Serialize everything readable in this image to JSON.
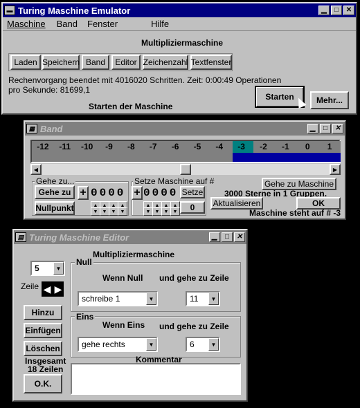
{
  "main": {
    "title": "Turing Maschine Emulator",
    "menu": [
      "Maschine",
      "Band",
      "Fenster",
      "Hilfe"
    ],
    "machine_name": "Multipliziermaschine",
    "toolbar": [
      "Laden",
      "Speichern",
      "Band",
      "Editor",
      "Zeichenzahl",
      "Textfenster"
    ],
    "status_line1": "Rechenvorgang beendet mit 4016020 Schritten. Zeit: 0:00:49 Operationen",
    "status_line2": "pro Sekunde: 81699,1",
    "start_caption": "Starten der Maschine",
    "start_button": "Starten",
    "more_button": "Mehr..."
  },
  "band": {
    "title": "Band",
    "cells": [
      "-12",
      "-11",
      "-10",
      "-9",
      "-8",
      "-7",
      "-6",
      "-5",
      "-4",
      "-3",
      "-2",
      "-1",
      "0",
      "1"
    ],
    "goto_group": "Gehe zu...",
    "goto_button": "Gehe zu",
    "zero_button": "Nullpunkt",
    "goto_digits": "0000",
    "set_group": "Setze Maschine auf #",
    "set_digits": "0000",
    "set_button": "Setze",
    "set_value": "0",
    "goto_machine_button": "Gehe zu Maschine",
    "stars_info": "3000 Sterne in   1 Gruppen.",
    "refresh_button": "Aktualisieren",
    "ok_button": "OK",
    "status": "Maschine steht auf # -3"
  },
  "editor": {
    "title": "Turing Maschine Editor",
    "machine_name": "Multipliziermaschine",
    "line_select": "5",
    "line_label": "Zeile",
    "add_button": "Hinzu",
    "insert_button": "Einfügen",
    "delete_button": "Löschen",
    "total_line1": "Insgesamt",
    "total_line2": "18 Zeilen",
    "ok_button": "O.K.",
    "null_group": "Null",
    "null_if": "Wenn Null",
    "null_goto": "und gehe zu Zeile",
    "null_action": "schreibe 1",
    "null_line": "11",
    "eins_group": "Eins",
    "eins_if": "Wenn Eins",
    "eins_goto": "und gehe zu Zeile",
    "eins_action": "gehe rechts",
    "eins_line": "6",
    "comment_label": "Kommentar",
    "comment_text": ""
  }
}
